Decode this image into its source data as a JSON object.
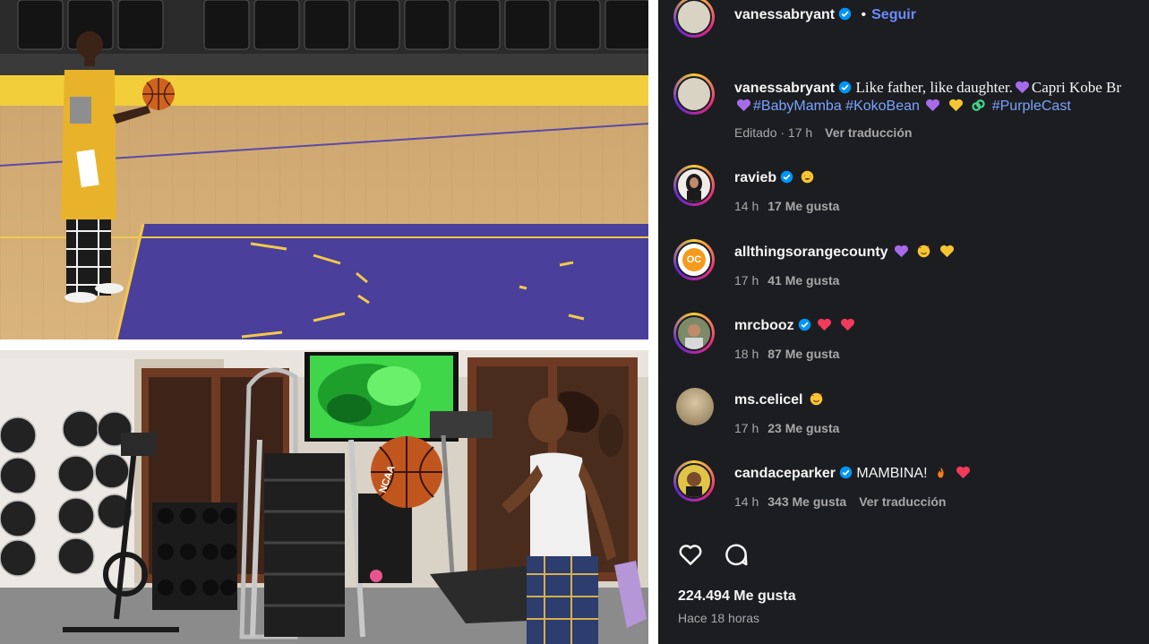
{
  "post": {
    "author": "vanessabryant",
    "separator": "•",
    "follow_label": "Seguir",
    "caption_user": "vanessabryant",
    "caption_text": "Like father, like daughter.",
    "caption_text_2": "Capri Kobe Br",
    "hashtags": [
      "#BabyMamba",
      "#KokoBean",
      "#PurpleCast"
    ],
    "edited_meta": "Editado · 17 h",
    "translate_label": "Ver traducción"
  },
  "comments": [
    {
      "user": "ravieb",
      "text": "",
      "time": "14 h",
      "likes": "17 Me gusta",
      "verified": true,
      "translate": ""
    },
    {
      "user": "allthingsorangecounty",
      "text": "",
      "time": "17 h",
      "likes": "41 Me gusta",
      "verified": false,
      "translate": ""
    },
    {
      "user": "mrcbooz",
      "text": "",
      "time": "18 h",
      "likes": "87 Me gusta",
      "verified": true,
      "translate": ""
    },
    {
      "user": "ms.celicel",
      "text": "",
      "time": "17 h",
      "likes": "23 Me gusta",
      "verified": false,
      "translate": ""
    },
    {
      "user": "candaceparker",
      "text": "MAMBINA!",
      "time": "14 h",
      "likes": "343 Me gusta",
      "verified": true,
      "translate": "Ver traducción"
    }
  ],
  "footer": {
    "likes_total": "224.494 Me gusta",
    "posted_ago": "Hace 18 horas"
  },
  "avatar_badge": {
    "orange_county": "OC"
  },
  "ball_text": {
    "brand": "NCAA"
  },
  "colors": {
    "panel_bg": "#1c1d21",
    "link": "#7aa3ff",
    "verified": "#0095f6",
    "court_purple": "#4a3f9a",
    "court_gold": "#f2c94c"
  },
  "icons": [
    "verified-badge-icon",
    "heart-icon",
    "comment-icon",
    "purple-heart-emoji",
    "yellow-heart-emoji",
    "heart-eyes-emoji",
    "red-heart-emoji",
    "fire-emoji"
  ]
}
